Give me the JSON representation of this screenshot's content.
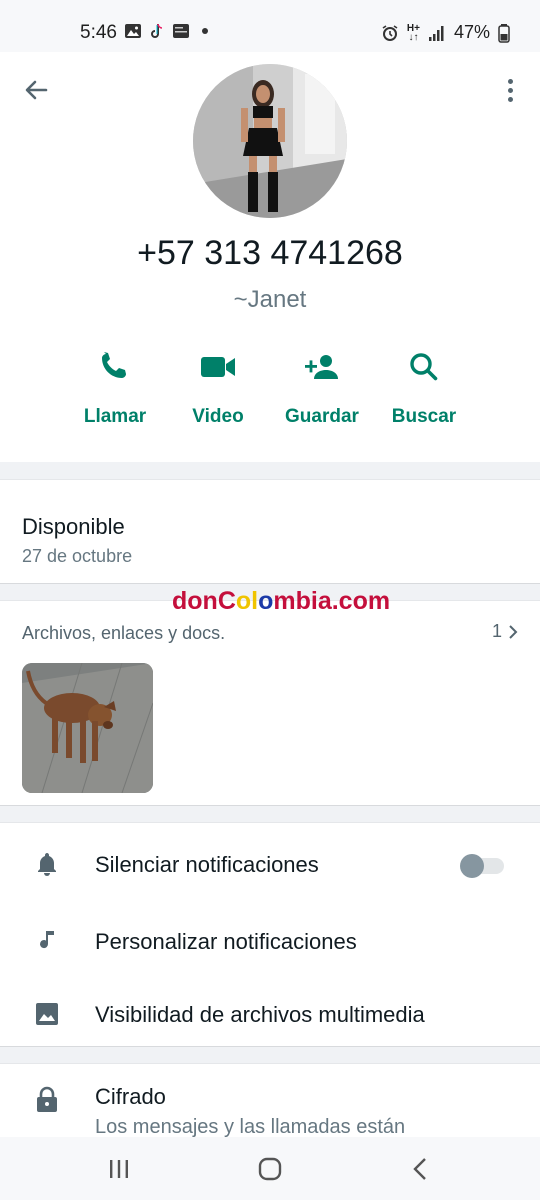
{
  "status_bar": {
    "time": "5:46",
    "battery": "47%",
    "network": "H+"
  },
  "contact": {
    "phone": "+57 313 4741268",
    "push_name": "~Janet"
  },
  "actions": [
    {
      "label": "Llamar",
      "icon": "phone-icon"
    },
    {
      "label": "Video",
      "icon": "video-icon"
    },
    {
      "label": "Guardar",
      "icon": "add-contact-icon"
    },
    {
      "label": "Buscar",
      "icon": "search-icon"
    }
  ],
  "about": {
    "status": "Disponible",
    "date": "27 de octubre"
  },
  "watermark": {
    "part1": "donC",
    "part2": "ol",
    "part3": "o",
    "part4": "mbia.com"
  },
  "media": {
    "title": "Archivos, enlaces y docs.",
    "count": "1"
  },
  "settings": [
    {
      "label": "Silenciar notificaciones",
      "icon": "bell-icon",
      "toggle": false
    },
    {
      "label": "Personalizar notificaciones",
      "icon": "music-note-icon"
    },
    {
      "label": "Visibilidad de archivos multimedia",
      "icon": "image-icon"
    }
  ],
  "encryption": {
    "title": "Cifrado",
    "subtitle": "Los mensajes y las llamadas están"
  },
  "colors": {
    "accent": "#008069",
    "icon_gray": "#54656f"
  }
}
